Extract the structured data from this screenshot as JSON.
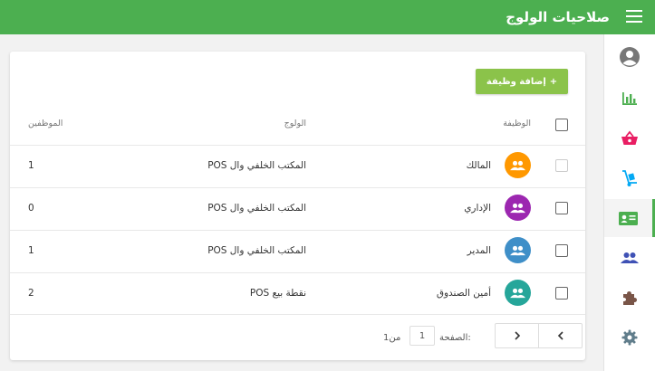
{
  "header": {
    "title": "صلاحيات الولوج",
    "menu_icon": "hamburger-menu-icon"
  },
  "colors": {
    "header": "#4caf50",
    "accent": "#8bc34a",
    "owner": "#ff9800",
    "admin": "#9c27b0",
    "manager": "#3f8fc8",
    "cashier": "#26a69a"
  },
  "sidebar": {
    "items": [
      {
        "icon": "user-account-icon",
        "color": "#777777"
      },
      {
        "icon": "bar-chart-icon",
        "color": "#4caf50"
      },
      {
        "icon": "shopping-basket-icon",
        "color": "#e91e63"
      },
      {
        "icon": "hand-truck-icon",
        "color": "#03a9f4"
      },
      {
        "icon": "id-card-icon",
        "color": "#4caf50",
        "active": true
      },
      {
        "icon": "people-icon",
        "color": "#3f51b5"
      },
      {
        "icon": "puzzle-piece-icon",
        "color": "#795548"
      },
      {
        "icon": "gear-icon",
        "color": "#607d8b"
      }
    ]
  },
  "toolbar": {
    "add_label": "إضافة وظيفة",
    "add_plus": "+"
  },
  "table": {
    "headers": {
      "job": "الوظيفة",
      "access": "الولوج",
      "employees": "الموظفين"
    },
    "rows": [
      {
        "job": "المالك",
        "access": "المكتب الخلفي وال POS",
        "employees": "1"
      },
      {
        "job": "الإداري",
        "access": "المكتب الخلفي وال POS",
        "employees": "0"
      },
      {
        "job": "المدير",
        "access": "المكتب الخلفي وال POS",
        "employees": "1"
      },
      {
        "job": "أمين الصندوق",
        "access": "نقطة بيع POS",
        "employees": "2"
      }
    ]
  },
  "pagination": {
    "page_label": "الصفحة:",
    "page_value": "1",
    "of_label": "من1"
  }
}
